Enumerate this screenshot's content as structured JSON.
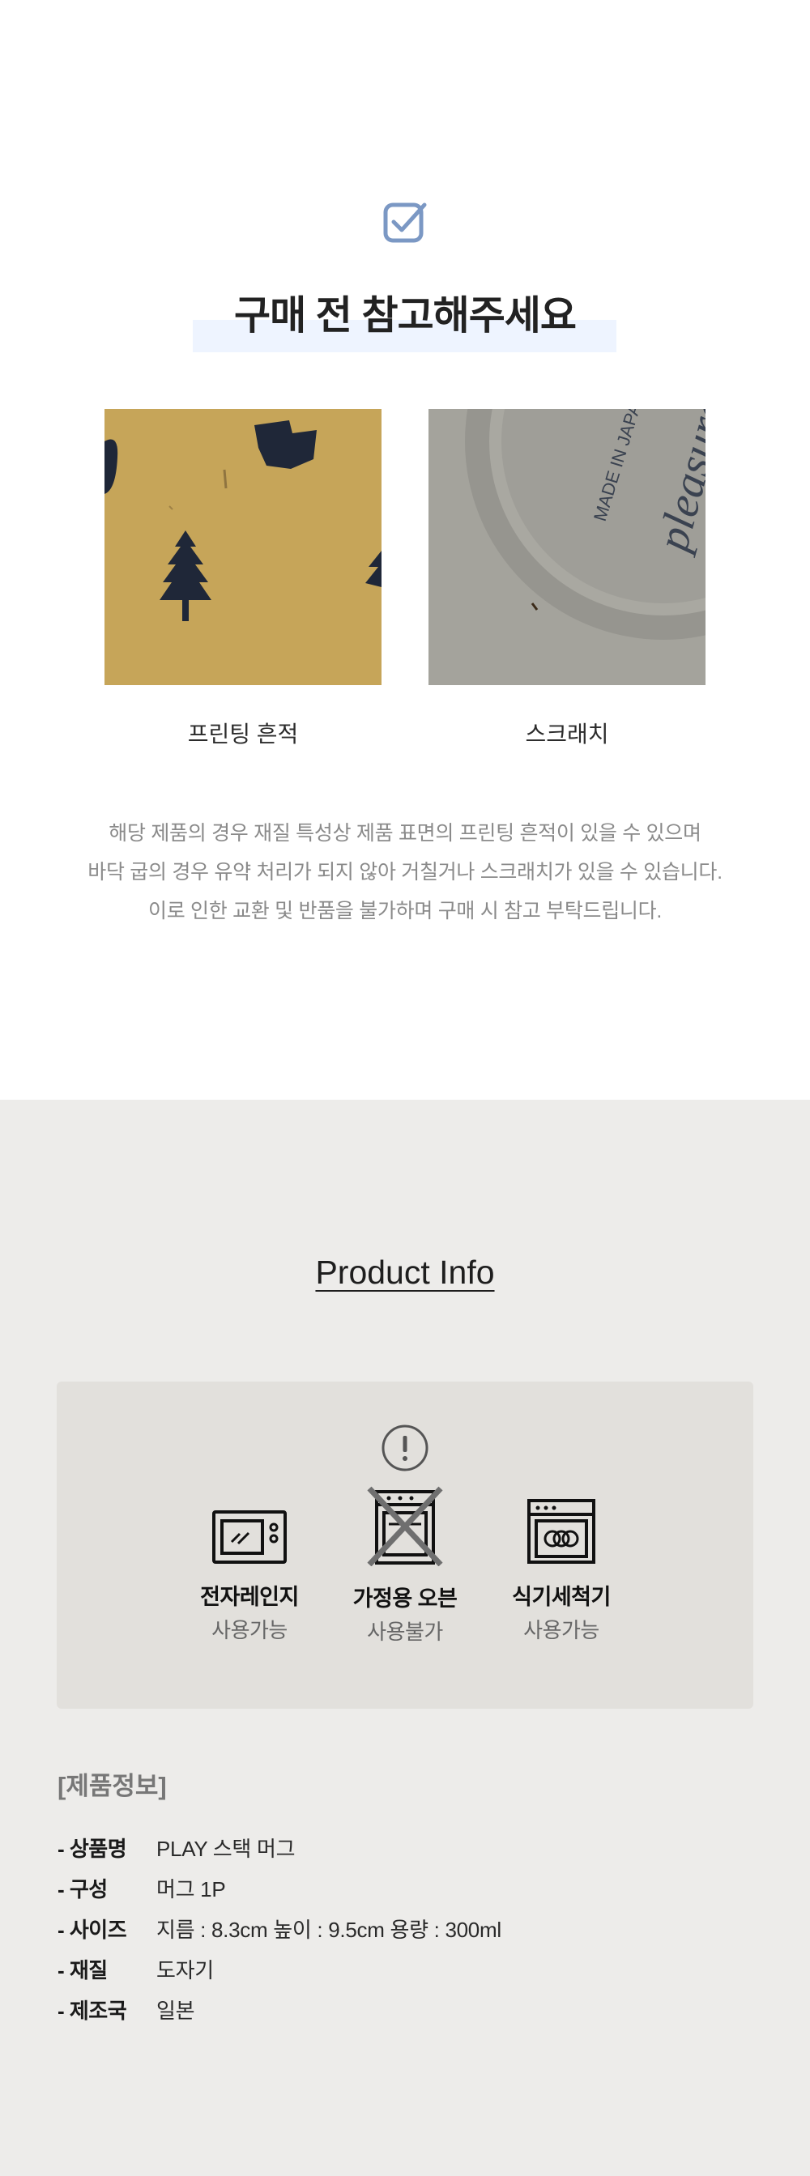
{
  "notice": {
    "icon": "checkbox-icon",
    "title": "구매 전 참고해주세요",
    "highlight_color": "#eef4ff",
    "photos": [
      {
        "caption": "프린팅 흔적"
      },
      {
        "caption": "스크래치",
        "stamp_text": "MADE IN JAPAN",
        "brand_text": "pleasure"
      }
    ],
    "description": [
      "해당 제품의 경우 재질 특성상 제품 표면의 프린팅 흔적이 있을 수 있으며",
      "바닥 굽의 경우 유약 처리가 되지 않아 거칠거나 스크래치가 있을 수 있습니다.",
      "이로 인한 교환 및 반품을 불가하며 구매 시 참고 부탁드립니다."
    ]
  },
  "info": {
    "heading": "Product Info",
    "background": "#edecea",
    "alert_icon": "exclamation-circle-icon",
    "care": [
      {
        "icon": "microwave-icon",
        "name": "전자레인지",
        "status": "사용가능"
      },
      {
        "icon": "oven-crossed-icon",
        "name": "가정용 오븐",
        "status": "사용불가"
      },
      {
        "icon": "dishwasher-icon",
        "name": "식기세척기",
        "status": "사용가능"
      }
    ],
    "spec_title": "[제품정보]",
    "specs": [
      {
        "key": "- 상품명",
        "value": "PLAY 스택 머그"
      },
      {
        "key": "- 구성",
        "value": "머그 1P"
      },
      {
        "key": "- 사이즈",
        "value": "지름 : 8.3cm  높이 : 9.5cm 용량 : 300ml"
      },
      {
        "key": "- 재질",
        "value": "도자기"
      },
      {
        "key": "- 제조국",
        "value": "일본"
      }
    ]
  }
}
